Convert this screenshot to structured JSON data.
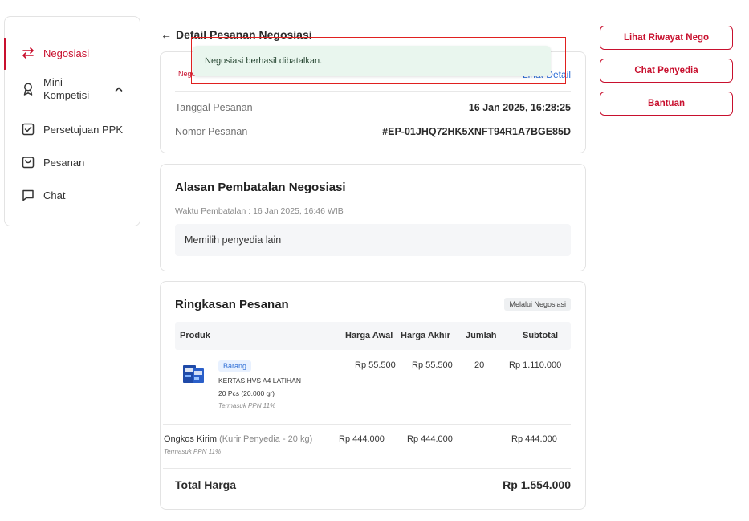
{
  "sidebar": {
    "items": [
      {
        "label": "Negosiasi",
        "icon": "swap-arrows-icon",
        "active": true
      },
      {
        "label_line1": "Mini",
        "label_line2": "Kompetisi",
        "icon": "award-icon",
        "active": false
      },
      {
        "label": "Persetujuan PPK",
        "icon": "checkbox-icon",
        "active": false
      },
      {
        "label": "Pesanan",
        "icon": "bag-icon",
        "active": false
      },
      {
        "label": "Chat",
        "icon": "chat-icon",
        "active": false
      }
    ]
  },
  "header": {
    "back_arrow": "←",
    "title": "Detail Pesanan Negosiasi"
  },
  "order": {
    "tag": "Nego",
    "link": "Lihat Detail",
    "date_label": "Tanggal Pesanan",
    "date_value": "16 Jan 2025, 16:28:25",
    "number_label": "Nomor Pesanan",
    "number_value": "#EP-01JHQ72HK5XNFT94R1A7BGE85D"
  },
  "cancel": {
    "title": "Alasan Pembatalan Negosiasi",
    "time": "Waktu Pembatalan   : 16 Jan 2025, 16:46 WIB",
    "reason": "Memilih penyedia lain"
  },
  "summary": {
    "title": "Ringkasan Pesanan",
    "badge": "Melalui Negosiasi",
    "headers": {
      "produk": "Produk",
      "awal": "Harga Awal",
      "akhir": "Harga Akhir",
      "jumlah": "Jumlah",
      "subtotal": "Subtotal"
    },
    "product": {
      "type": "Barang",
      "name": "KERTAS HVS A4 LATIHAN",
      "qty_desc": "20 Pcs (20.000 gr)",
      "ppn": "Termasuk PPN 11%",
      "harga_awal": "Rp 55.500",
      "harga_akhir": "Rp 55.500",
      "jumlah": "20",
      "subtotal": "Rp 1.110.000"
    },
    "shipping": {
      "label": "Ongkos Kirim",
      "detail": "(Kurir Penyedia - 20 kg)",
      "ppn": "Termasuk PPN 11%",
      "harga_awal": "Rp 444.000",
      "harga_akhir": "Rp 444.000",
      "subtotal": "Rp 444.000"
    },
    "total_label": "Total Harga",
    "total_value": "Rp 1.554.000"
  },
  "actions": {
    "riwayat": "Lihat Riwayat Nego",
    "chat": "Chat Penyedia",
    "bantuan": "Bantuan"
  },
  "toast": {
    "message": "Negosiasi berhasil dibatalkan."
  },
  "colors": {
    "accent": "#c8102e",
    "link": "#2f6fd6",
    "toast_bg": "#e9f6ee"
  }
}
